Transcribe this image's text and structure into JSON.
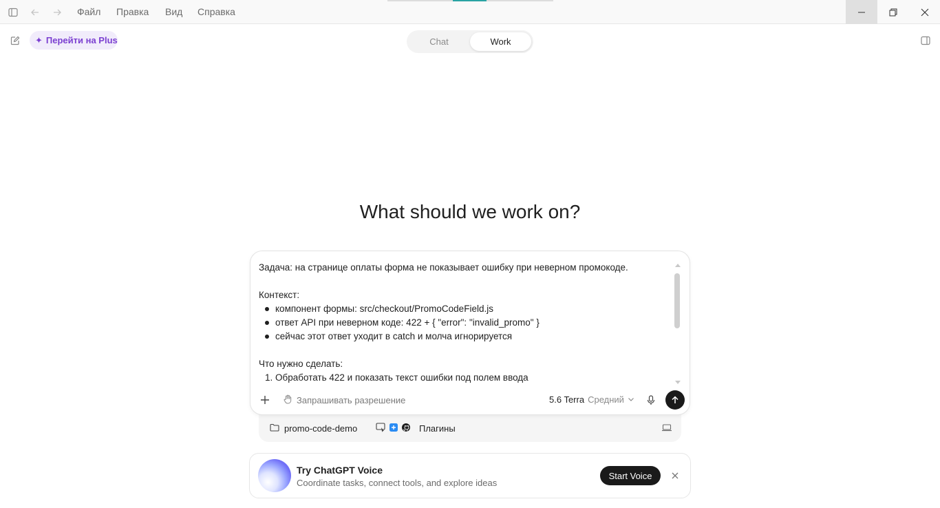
{
  "menu": {
    "items": [
      "Файл",
      "Правка",
      "Вид",
      "Справка"
    ]
  },
  "header": {
    "upgrade_label": "Перейти на Plus",
    "tabs": [
      {
        "label": "Chat",
        "active": false
      },
      {
        "label": "Work",
        "active": true
      }
    ]
  },
  "main": {
    "heading": "What should we work on?"
  },
  "composer": {
    "prompt": {
      "line1": "Задача: на странице оплаты форма не показывает ошибку при неверном промокоде.",
      "context_label": "Контекст:",
      "bullets": [
        "компонент формы: src/checkout/PromoCodeField.js",
        "ответ API при неверном коде: 422 + { \"error\": \"invalid_promo\" }",
        "сейчас этот ответ уходит в catch и молча игнорируется"
      ],
      "todo_label": "Что нужно сделать:",
      "steps": [
        "Обработать 422 и показать текст ошибки под полем ввода"
      ]
    },
    "permission_label": "Запрашивать разрешение",
    "model_name": "5.6 Terra",
    "model_effort": "Средний"
  },
  "project": {
    "folder": "promo-code-demo",
    "plugins_label": "Плагины"
  },
  "voice_card": {
    "title": "Try ChatGPT Voice",
    "subtitle": "Coordinate tasks, connect tools, and explore ideas",
    "button": "Start Voice"
  },
  "colors": {
    "accent_purple": "#7b3fd1",
    "send_button": "#1a1a1a",
    "progress_teal": "#2aa3a3"
  }
}
